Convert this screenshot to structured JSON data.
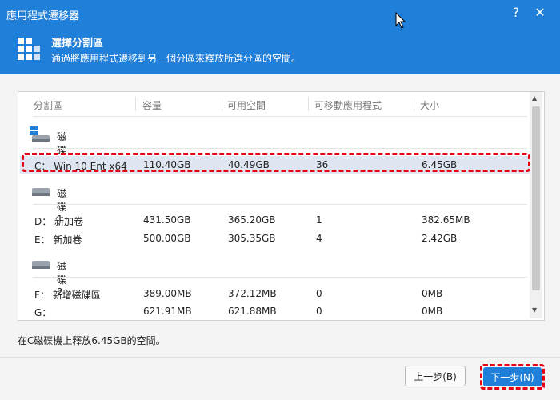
{
  "window": {
    "title": "應用程式遷移器",
    "help_label": "?",
    "close_label": "✕"
  },
  "header": {
    "title": "選擇分割區",
    "description": "通過將應用程式遷移到另一個分區來釋放所選分區的空間。",
    "icon": "grid-icon"
  },
  "table": {
    "columns": [
      "分割區",
      "容量",
      "可用空間",
      "可移動應用程式",
      "大小"
    ],
    "disks": [
      {
        "label": "磁碟 0",
        "icon": "windows-disk-icon",
        "partitions": [
          {
            "name": "C： Win 10 Ent x64",
            "capacity": "110.40GB",
            "free": "40.49GB",
            "apps": "36",
            "size": "6.45GB",
            "selected": true
          }
        ]
      },
      {
        "label": "磁碟 1",
        "icon": "disk-icon",
        "partitions": [
          {
            "name": "D： 新加卷",
            "capacity": "431.50GB",
            "free": "365.20GB",
            "apps": "1",
            "size": "382.65MB",
            "selected": false
          },
          {
            "name": "E： 新加卷",
            "capacity": "500.00GB",
            "free": "305.35GB",
            "apps": "4",
            "size": "2.42GB",
            "selected": false
          }
        ]
      },
      {
        "label": "磁碟 2",
        "icon": "disk-icon",
        "partitions": [
          {
            "name": "F： 新增磁碟區",
            "capacity": "389.00MB",
            "free": "372.12MB",
            "apps": "0",
            "size": "0MB",
            "selected": false
          },
          {
            "name": "G：",
            "capacity": "621.91MB",
            "free": "621.88MB",
            "apps": "0",
            "size": "0MB",
            "selected": false
          }
        ]
      }
    ]
  },
  "info_text": "在C磁碟機上釋放6.45GB的空間。",
  "buttons": {
    "back": "上一步(B)",
    "next": "下一步(N)"
  },
  "colors": {
    "accent": "#1f7fd9",
    "highlight": "#e60012",
    "selected_row": "#dfe6f2"
  }
}
